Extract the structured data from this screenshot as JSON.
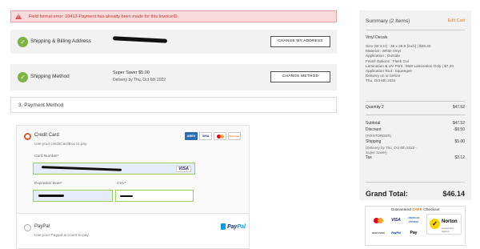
{
  "error": {
    "message": "Field format error: 10412-Payment has already been made for this InvoiceID."
  },
  "steps": {
    "billing": {
      "title": "Shipping & Billing Address",
      "button": "CHANGE MY ADDRESS"
    },
    "shipping": {
      "title": "Shipping Method",
      "method": "Super Saver $5.00",
      "delivery": "Delivery by Thu, Oct 6th 2022",
      "button": "CHANGE METHOD"
    },
    "payment": {
      "title": "3. Payment Method"
    }
  },
  "payment": {
    "credit_card": {
      "label": "Credit Card",
      "description": "Use your creditCardBox to pay.",
      "card_logos": [
        "AMEX",
        "VISA",
        "MasterCard",
        "Discover"
      ],
      "card_number_label": "Card Number*",
      "card_type_mark": "VISA",
      "expiration_label": "Expiration Date*",
      "cvv_label": "CVV*"
    },
    "paypal": {
      "label": "PayPal",
      "description": "Use your Paypal account to pay.",
      "logo_a": "Pay",
      "logo_b": "Pal"
    }
  },
  "summary": {
    "title": "Summary (2 Items)",
    "edit_cart": "Edit Cart",
    "item_name": "Vinyl Decals",
    "details": [
      "Size (W X H) : 36 x 28.8 (inch) | $25.20",
      "Material : White Vinyl",
      "Application : Outside",
      "Finish Options : Flash Cut",
      "Lamination & UV Print : Matt Lamination Only | $7.20",
      "Application Tool : Squeegee",
      "Delivery on or before",
      "Thu, Oct 6th 2022"
    ],
    "quantity_label": "Quantity 2",
    "quantity_price": "$47.52",
    "subtotal_label": "Subtotal",
    "subtotal": "$47.52",
    "discount_label": "Discount",
    "discount_code": "(FIRSTORDER)",
    "discount": "-$9.50",
    "shipping_label": "Shipping",
    "shipping_note": "(Delivery by Thu, Oct 6th 2022 - Super Saver)",
    "shipping": "$5.00",
    "tax_label": "Tax",
    "tax": "$3.12",
    "grand_total_label": "Grand Total:",
    "grand_total": "$46.14"
  },
  "secure_checkout": {
    "title_a": "Guaranteed",
    "title_b": "SAFE",
    "title_c": "Checkout",
    "badges": [
      "mastercard",
      "VISA",
      "AMERICAN EXPRESS",
      "DISCOVER",
      "PayPal",
      "Pay"
    ],
    "norton": "Norton",
    "norton_sub": "powered by digicert"
  },
  "colors": {
    "accent": "#e05a33",
    "success": "#7cb342",
    "error_bg": "#f8dada",
    "panel": "#f2f2f2"
  }
}
